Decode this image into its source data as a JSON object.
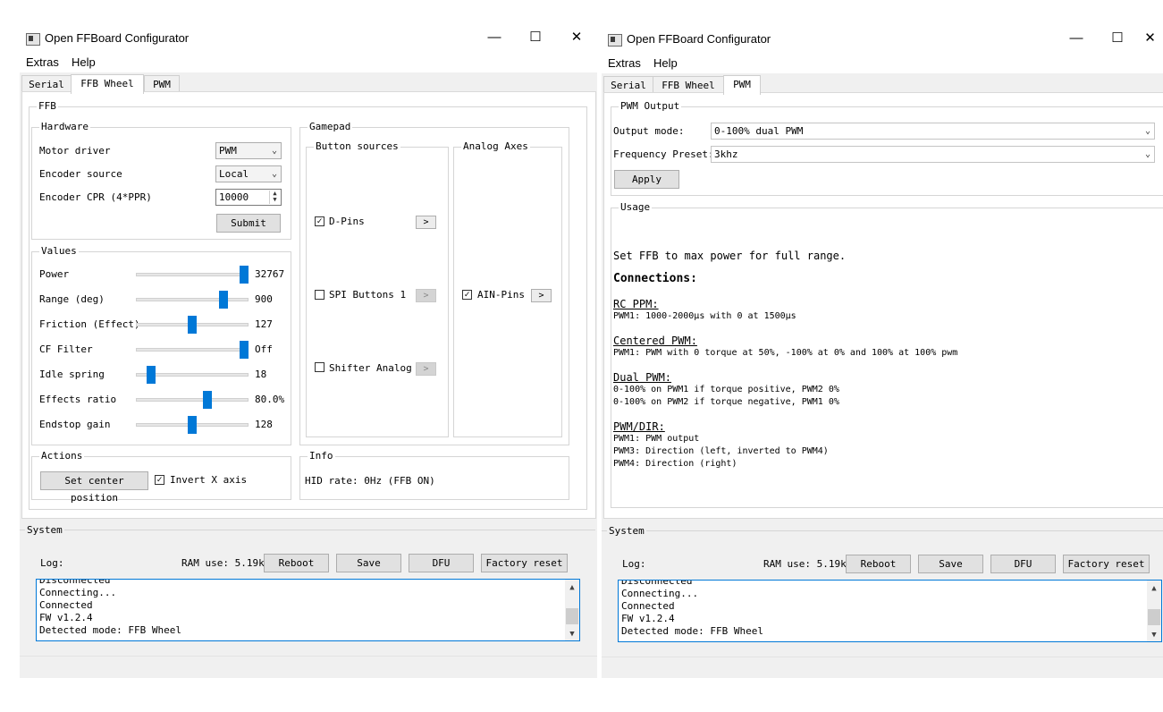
{
  "app": {
    "title": "Open FFBoard Configurator"
  },
  "window_controls": {
    "minimize": "—",
    "maximize": "☐",
    "close": "✕"
  },
  "menu": [
    "Extras",
    "Help"
  ],
  "tabs": [
    "Serial",
    "FFB Wheel",
    "PWM"
  ],
  "ffb_tab": {
    "group_title": "FFB",
    "hardware": {
      "title": "Hardware",
      "motor_driver": {
        "label": "Motor driver",
        "value": "PWM"
      },
      "encoder_source": {
        "label": "Encoder source",
        "value": "Local"
      },
      "encoder_cpr": {
        "label": "Encoder CPR (4*PPR)",
        "value": "10000"
      },
      "submit": "Submit"
    },
    "values": {
      "title": "Values",
      "sliders": [
        {
          "label": "Power",
          "value": "32767",
          "level": 1.0
        },
        {
          "label": "Range (deg)",
          "value": "900",
          "level": 0.8
        },
        {
          "label": "Friction (Effect)",
          "value": "127",
          "level": 0.5
        },
        {
          "label": "CF Filter",
          "value": "Off",
          "level": 1.0
        },
        {
          "label": "Idle spring",
          "value": "18",
          "level": 0.1
        },
        {
          "label": "Effects ratio",
          "value": "80.0%",
          "level": 0.65
        },
        {
          "label": "Endstop gain",
          "value": "128",
          "level": 0.5
        }
      ]
    },
    "gamepad": {
      "title": "Gamepad",
      "button_sources": {
        "title": "Button sources",
        "items": [
          {
            "label": "D-Pins",
            "checked": true,
            "arrow": ">"
          },
          {
            "label": "SPI Buttons 1",
            "checked": false,
            "arrow": ">"
          },
          {
            "label": "Shifter Analog",
            "checked": false,
            "arrow": ">"
          }
        ]
      },
      "analog_axes": {
        "title": "Analog Axes",
        "items": [
          {
            "label": "AIN-Pins",
            "checked": true,
            "arrow": ">"
          }
        ]
      }
    },
    "actions": {
      "title": "Actions",
      "center_button": "Set center position",
      "invert_label": "Invert X axis",
      "invert_checked": true
    },
    "info": {
      "title": "Info",
      "hid_rate": "HID rate: 0Hz (FFB ON)"
    }
  },
  "pwm_tab": {
    "output": {
      "title": "PWM Output",
      "mode_label": "Output mode:",
      "mode_value": "0-100% dual PWM",
      "freq_label": "Frequency Preset:",
      "freq_value": "3khz",
      "apply": "Apply"
    },
    "usage": {
      "title": "Usage",
      "intro": "Set FFB to max power for full range.",
      "connections": "Connections:",
      "rc_title": "RC PPM:",
      "rc_lines": [
        "PWM1: 1000-2000µs with 0 at 1500µs"
      ],
      "centered_title": "Centered PWM:",
      "centered_lines": [
        "PWM1: PWM with 0 torque at 50%, -100% at 0% and 100% at 100% pwm"
      ],
      "dual_title": "Dual PWM:",
      "dual_lines": [
        "0-100% on PWM1 if torque positive, PWM2 0%",
        "0-100% on PWM2 if torque negative, PWM1 0%"
      ],
      "dir_title": "PWM/DIR:",
      "dir_lines": [
        "PWM1: PWM output",
        "PWM3: Direction (left, inverted to PWM4)",
        "PWM4: Direction (right)"
      ]
    }
  },
  "system": {
    "title": "System",
    "log_label": "Log:",
    "ram": "RAM use: 5.19k",
    "buttons": [
      "Reboot",
      "Save",
      "DFU",
      "Factory reset"
    ],
    "log_lines": [
      "Disconnected",
      "Connecting...",
      "Connected",
      "FW v1.2.4",
      "Detected mode: FFB Wheel"
    ],
    "scroll_up": "▲",
    "scroll_down": "▼"
  }
}
